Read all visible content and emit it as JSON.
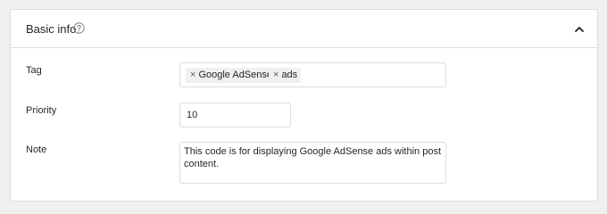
{
  "panel": {
    "title": "Basic info",
    "help_icon": "help-circle-icon",
    "collapse_icon": "chevron-up-icon"
  },
  "fields": {
    "tag": {
      "label": "Tag",
      "chips": [
        "Google AdSense",
        "ads"
      ],
      "remove_symbol": "×"
    },
    "priority": {
      "label": "Priority",
      "value": "10"
    },
    "note": {
      "label": "Note",
      "value": "This code is for displaying Google AdSense ads within post content."
    }
  },
  "colors": {
    "background": "#f0f0f1",
    "panel": "#ffffff",
    "border": "#dcdcde",
    "text": "#1d2327",
    "chip": "#f0f0f1"
  }
}
